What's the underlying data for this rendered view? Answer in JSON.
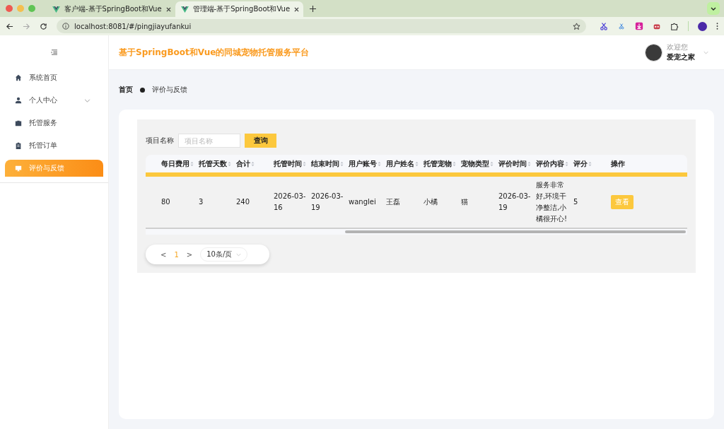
{
  "browser": {
    "tabs": [
      {
        "title": "客户端-基于SpringBoot和Vue",
        "selected": false
      },
      {
        "title": "管理端-基于SpringBoot和Vue",
        "selected": true
      }
    ],
    "url": "localhost:8081/#/pingjiayufankui"
  },
  "header": {
    "title": "基于SpringBoot和Vue的同城宠物托管服务平台",
    "greeting": "欢迎您",
    "user_name": "爱宠之家"
  },
  "sidebar": {
    "items": [
      {
        "label": "系统首页",
        "kind": "link",
        "selected": false
      },
      {
        "label": "个人中心",
        "kind": "group",
        "selected": false
      },
      {
        "label": "托管服务",
        "kind": "link",
        "selected": false
      },
      {
        "label": "托管订单",
        "kind": "link",
        "selected": false
      },
      {
        "label": "评价与反馈",
        "kind": "link",
        "selected": true
      }
    ]
  },
  "breadcrumb": [
    "首页",
    "评价与反馈"
  ],
  "search": {
    "label": "项目名称",
    "placeholder": "项目名称",
    "button": "查询"
  },
  "table": {
    "columns": [
      {
        "label": "每日费用",
        "sortable": true
      },
      {
        "label": "托管天数",
        "sortable": true
      },
      {
        "label": "合计",
        "sortable": true
      },
      {
        "label": "托管时间",
        "sortable": true
      },
      {
        "label": "结束时间",
        "sortable": true
      },
      {
        "label": "用户账号",
        "sortable": true
      },
      {
        "label": "用户姓名",
        "sortable": true
      },
      {
        "label": "托管宠物",
        "sortable": true
      },
      {
        "label": "宠物类型",
        "sortable": true
      },
      {
        "label": "评价时间",
        "sortable": true
      },
      {
        "label": "评价内容",
        "sortable": true
      },
      {
        "label": "评分",
        "sortable": true
      },
      {
        "label": "操作",
        "sortable": false
      }
    ],
    "rows": [
      {
        "cells": [
          "80",
          "3",
          "240",
          "2026-03-16",
          "2026-03-19",
          "wanglei",
          "王磊",
          "小橘",
          "猫",
          "2026-03-19",
          "服务非常好,环境干净整洁,小橘很开心!",
          "5"
        ],
        "action": "查看"
      }
    ]
  },
  "pagination": {
    "prev": "<",
    "pages": [
      {
        "label": "1",
        "selected": true
      }
    ],
    "next": ">",
    "page_size": "10条/页"
  }
}
